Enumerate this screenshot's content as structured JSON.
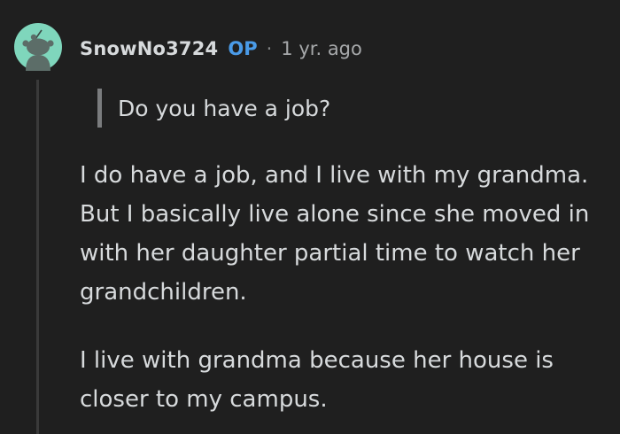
{
  "comment": {
    "author": "SnowNo3724",
    "badge": "OP",
    "separator": "·",
    "timestamp": "1 yr. ago",
    "avatar_icon": "reddit-snoo-avatar-icon",
    "quote": "Do you have a job?",
    "paragraphs": [
      "I do have a job, and I live with my grandma. But I basically live alone since she moved in with her daughter partial time to watch her grandchildren.",
      "I live with grandma because her house is closer to my campus."
    ]
  },
  "colors": {
    "background": "#1f1f1f",
    "avatar_bg": "#7fd6bc",
    "op_badge": "#4a9be8",
    "text": "#d7dadc",
    "muted": "#a6a8aa"
  }
}
